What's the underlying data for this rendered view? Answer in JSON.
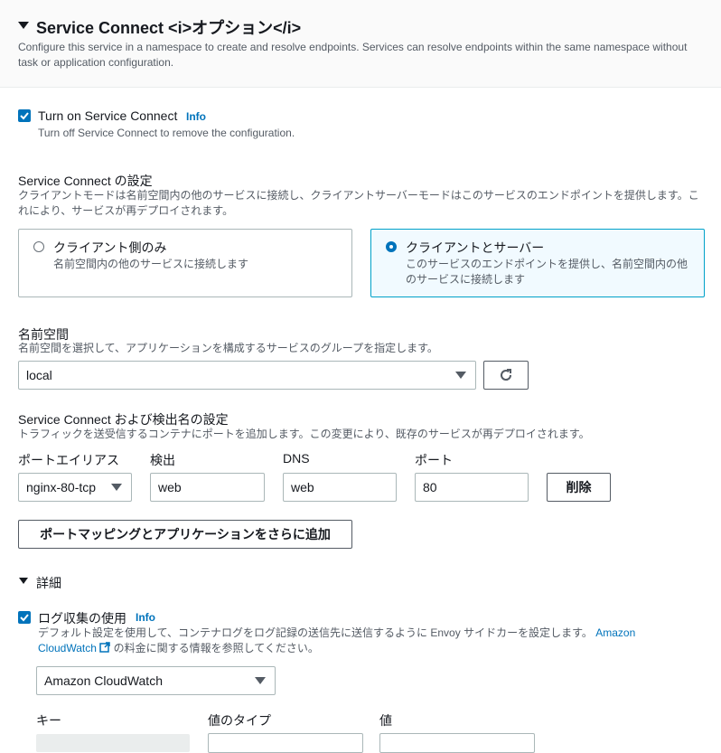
{
  "header": {
    "title": "Service Connect <i>オプション</i>",
    "description": "Configure this service in a namespace to create and resolve endpoints. Services can resolve endpoints within the same namespace without task or application configuration."
  },
  "turn_on": {
    "label": "Turn on Service Connect",
    "info": "Info",
    "description": "Turn off Service Connect to remove the configuration.",
    "checked": true
  },
  "config": {
    "title": "Service Connect の設定",
    "description": "クライアントモードは名前空間内の他のサービスに接続し、クライアントサーバーモードはこのサービスのエンドポイントを提供します。これにより、サービスが再デプロイされます。",
    "options": [
      {
        "label": "クライアント側のみ",
        "description": "名前空間内の他のサービスに接続します",
        "selected": false
      },
      {
        "label": "クライアントとサーバー",
        "description": "このサービスのエンドポイントを提供し、名前空間内の他のサービスに接続します",
        "selected": true
      }
    ]
  },
  "namespace": {
    "title": "名前空間",
    "description": "名前空間を選択して、アプリケーションを構成するサービスのグループを指定します。",
    "value": "local",
    "refresh_icon": "refresh-icon"
  },
  "discovery": {
    "title": "Service Connect および検出名の設定",
    "description": "トラフィックを送受信するコンテナにポートを追加します。この変更により、既存のサービスが再デプロイされます。",
    "columns": [
      "ポートエイリアス",
      "検出",
      "DNS",
      "ポート"
    ],
    "row": {
      "port_alias": "nginx-80-tcp",
      "discovery": "web",
      "dns": "web",
      "port": "80"
    },
    "delete_label": "削除",
    "add_label": "ポートマッピングとアプリケーションをさらに追加"
  },
  "details": {
    "title": "詳細",
    "log_label": "ログ収集の使用",
    "log_info": "Info",
    "log_desc_1": "デフォルト設定を使用して、コンテナログをログ記録の送信先に送信するように Envoy サイドカーを設定します。",
    "log_link_1": "Amazon",
    "log_link_2": "CloudWatch",
    "log_desc_2": "の料金に関する情報を参照してください。",
    "log_checked": true,
    "destination": "Amazon CloudWatch",
    "columns": [
      "キー",
      "値のタイプ",
      "値"
    ]
  },
  "colors": {
    "accent": "#0073bb",
    "selected_border": "#00a1c9",
    "selected_bg": "#f1faff"
  }
}
